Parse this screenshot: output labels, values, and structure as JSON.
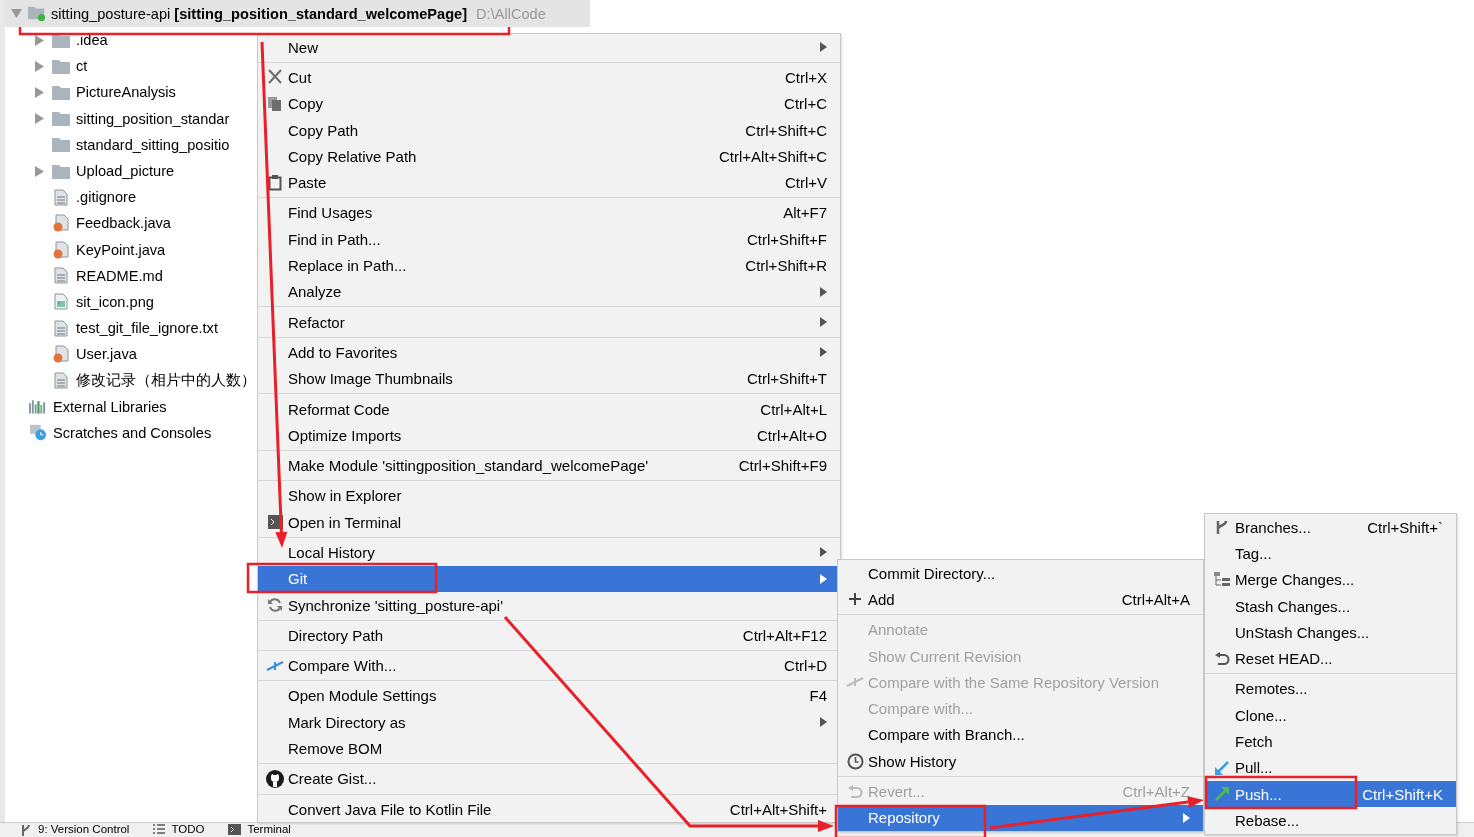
{
  "project_tree": {
    "nodes": [
      {
        "label": "sitting_posture-api **[sitting_position_standard_welcomePage]**",
        "path": "D:\\AllCode",
        "kind": "module",
        "expanded": true,
        "selected": true,
        "children": [
          {
            "label": ".idea",
            "kind": "folder",
            "expanded": false,
            "selected": false
          },
          {
            "label": "ct",
            "kind": "folder",
            "expanded": false,
            "selected": false
          },
          {
            "label": "PictureAnalysis",
            "kind": "folder",
            "expanded": false,
            "selected": false
          },
          {
            "label": "sitting_position_standar",
            "kind": "folder",
            "expanded": false,
            "selected": false
          },
          {
            "label": "standard_sitting_positio",
            "kind": "folder",
            "selected": false
          },
          {
            "label": "Upload_picture",
            "kind": "folder",
            "expanded": false,
            "selected": false
          },
          {
            "label": ".gitignore",
            "kind": "file",
            "selected": false
          },
          {
            "label": "Feedback.java",
            "kind": "java",
            "selected": false
          },
          {
            "label": "KeyPoint.java",
            "kind": "java",
            "selected": false
          },
          {
            "label": "README.md",
            "kind": "file",
            "selected": false
          },
          {
            "label": "sit_icon.png",
            "kind": "image",
            "selected": false
          },
          {
            "label": "test_git_file_ignore.txt",
            "kind": "file",
            "selected": false
          },
          {
            "label": "User.java",
            "kind": "java",
            "selected": false
          },
          {
            "label": "修改记录（相片中的人数）",
            "kind": "file",
            "selected": false
          }
        ]
      },
      {
        "label": "External Libraries",
        "kind": "libraries",
        "selected": false
      },
      {
        "label": "Scratches and Consoles",
        "kind": "scratches",
        "selected": false
      }
    ]
  },
  "context_menu": {
    "groups": [
      [
        {
          "label": "New",
          "submenu": true,
          "selected": false
        }
      ],
      [
        {
          "label": "Cut",
          "shortcut": "Ctrl+X",
          "selected": false
        },
        {
          "label": "Copy",
          "shortcut": "Ctrl+C",
          "selected": false
        },
        {
          "label": "Copy Path",
          "shortcut": "Ctrl+Shift+C",
          "selected": false
        },
        {
          "label": "Copy Relative Path",
          "shortcut": "Ctrl+Alt+Shift+C",
          "selected": false
        },
        {
          "label": "Paste",
          "shortcut": "Ctrl+V",
          "selected": false
        }
      ],
      [
        {
          "label": "Find Usages",
          "shortcut": "Alt+F7",
          "selected": false
        },
        {
          "label": "Find in Path...",
          "shortcut": "Ctrl+Shift+F",
          "selected": false
        },
        {
          "label": "Replace in Path...",
          "shortcut": "Ctrl+Shift+R",
          "selected": false
        },
        {
          "label": "Analyze",
          "submenu": true,
          "selected": false
        }
      ],
      [
        {
          "label": "Refactor",
          "submenu": true,
          "selected": false
        }
      ],
      [
        {
          "label": "Add to Favorites",
          "submenu": true,
          "selected": false
        },
        {
          "label": "Show Image Thumbnails",
          "shortcut": "Ctrl+Shift+T",
          "selected": false
        }
      ],
      [
        {
          "label": "Reformat Code",
          "shortcut": "Ctrl+Alt+L",
          "selected": false
        },
        {
          "label": "Optimize Imports",
          "shortcut": "Ctrl+Alt+O",
          "selected": false
        }
      ],
      [
        {
          "label": "Make Module 'sittingposition_standard_welcomePage'",
          "shortcut": "Ctrl+Shift+F9",
          "selected": false
        }
      ],
      [
        {
          "label": "Show in Explorer",
          "selected": false
        },
        {
          "label": "Open in Terminal",
          "selected": false
        }
      ],
      [
        {
          "label": "Local History",
          "submenu": true,
          "selected": false
        },
        {
          "label": "Git",
          "submenu": true,
          "selected": true
        },
        {
          "label": "Synchronize 'sitting_posture-api'",
          "selected": false
        }
      ],
      [
        {
          "label": "Directory Path",
          "shortcut": "Ctrl+Alt+F12",
          "selected": false
        }
      ],
      [
        {
          "label": "Compare With...",
          "shortcut": "Ctrl+D",
          "selected": false
        }
      ],
      [
        {
          "label": "Open Module Settings",
          "shortcut": "F4",
          "selected": false
        },
        {
          "label": "Mark Directory as",
          "submenu": true,
          "selected": false
        },
        {
          "label": "Remove BOM",
          "selected": false
        }
      ],
      [
        {
          "label": "Create Gist...",
          "selected": false
        }
      ],
      [
        {
          "label": "Convert Java File to Kotlin File",
          "shortcut": "Ctrl+Alt+Shift+",
          "selected": false
        }
      ]
    ]
  },
  "git_menu": {
    "groups": [
      [
        {
          "label": "Commit Directory...",
          "disabled": false,
          "selected": false
        },
        {
          "label": "Add",
          "shortcut": "Ctrl+Alt+A",
          "disabled": false,
          "selected": false
        }
      ],
      [
        {
          "label": "Annotate",
          "disabled": true,
          "selected": false
        },
        {
          "label": "Show Current Revision",
          "disabled": true,
          "selected": false
        },
        {
          "label": "Compare with the Same Repository Version",
          "disabled": true,
          "selected": false
        },
        {
          "label": "Compare with...",
          "disabled": true,
          "selected": false
        },
        {
          "label": "Compare with Branch...",
          "disabled": false,
          "selected": false
        },
        {
          "label": "Show History",
          "disabled": false,
          "selected": false
        }
      ],
      [
        {
          "label": "Revert...",
          "shortcut": "Ctrl+Alt+Z",
          "disabled": true,
          "selected": false
        },
        {
          "label": "Repository",
          "submenu": true,
          "disabled": false,
          "selected": true
        }
      ]
    ]
  },
  "repository_menu": {
    "groups": [
      [
        {
          "label": "Branches...",
          "shortcut": "Ctrl+Shift+`",
          "selected": false
        },
        {
          "label": "Tag...",
          "selected": false
        },
        {
          "label": "Merge Changes...",
          "selected": false
        },
        {
          "label": "Stash Changes...",
          "selected": false
        },
        {
          "label": "UnStash Changes...",
          "selected": false
        },
        {
          "label": "Reset HEAD...",
          "selected": false
        }
      ],
      [
        {
          "label": "Remotes...",
          "selected": false
        },
        {
          "label": "Clone...",
          "selected": false
        },
        {
          "label": "Fetch",
          "selected": false
        },
        {
          "label": "Pull...",
          "selected": false
        },
        {
          "label": "Push...",
          "shortcut": "Ctrl+Shift+K",
          "selected": true
        },
        {
          "label": "Rebase...",
          "selected": false
        }
      ]
    ]
  },
  "status_bar": {
    "tabs": [
      {
        "label": "9: Version Control"
      },
      {
        "label": "TODO"
      },
      {
        "label": "Terminal"
      }
    ]
  }
}
